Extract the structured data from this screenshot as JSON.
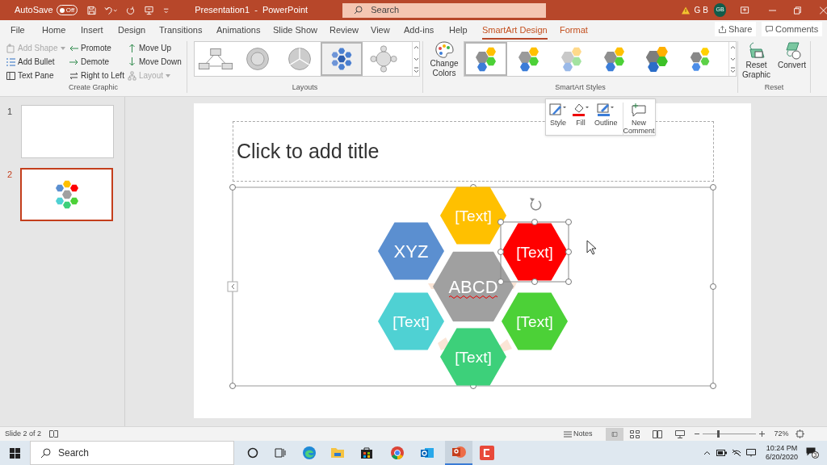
{
  "window": {
    "autosave_label": "AutoSave",
    "autosave_toggle": "Off",
    "autosave_on": false,
    "title": "Presentation1  -  PowerPoint",
    "search_placeholder": "Search",
    "user_initials": "G B",
    "avatar": "GB"
  },
  "tabs": [
    {
      "label": "File",
      "selected": false,
      "kind": "normal"
    },
    {
      "label": "Home",
      "selected": false,
      "kind": "normal"
    },
    {
      "label": "Insert",
      "selected": false,
      "kind": "normal"
    },
    {
      "label": "Design",
      "selected": false,
      "kind": "normal"
    },
    {
      "label": "Transitions",
      "selected": false,
      "kind": "normal"
    },
    {
      "label": "Animations",
      "selected": false,
      "kind": "normal"
    },
    {
      "label": "Slide Show",
      "selected": false,
      "kind": "normal"
    },
    {
      "label": "Review",
      "selected": false,
      "kind": "normal"
    },
    {
      "label": "View",
      "selected": false,
      "kind": "normal"
    },
    {
      "label": "Add-ins",
      "selected": false,
      "kind": "normal"
    },
    {
      "label": "Help",
      "selected": false,
      "kind": "normal"
    },
    {
      "label": "SmartArt Design",
      "selected": true,
      "kind": "contextual"
    },
    {
      "label": "Format",
      "selected": false,
      "kind": "contextual"
    }
  ],
  "share": "Share",
  "comments": "Comments",
  "create_graphic": {
    "label": "Create Graphic",
    "items": [
      {
        "label": "Add Shape",
        "disabled": true,
        "dropdown": true
      },
      {
        "label": "Add Bullet",
        "disabled": false,
        "dropdown": false
      },
      {
        "label": "Text Pane",
        "disabled": false,
        "dropdown": false
      },
      {
        "label": "Promote",
        "disabled": false,
        "dropdown": false
      },
      {
        "label": "Demote",
        "disabled": false,
        "dropdown": false
      },
      {
        "label": "Right to Left",
        "disabled": false,
        "dropdown": false
      },
      {
        "label": "Move Up",
        "disabled": false,
        "dropdown": false
      },
      {
        "label": "Move Down",
        "disabled": false,
        "dropdown": false
      },
      {
        "label": "Layout",
        "disabled": true,
        "dropdown": true
      }
    ]
  },
  "layouts": {
    "label": "Layouts",
    "thumbnails": [
      {
        "kind": "hierarchy",
        "selected": false
      },
      {
        "kind": "cycle",
        "selected": false
      },
      {
        "kind": "pie",
        "selected": false
      },
      {
        "kind": "hexagon",
        "selected": true
      },
      {
        "kind": "radial",
        "selected": false
      }
    ]
  },
  "smartart_styles": {
    "change_colors": "Change Colors",
    "label": "SmartArt Styles",
    "styles": [
      {
        "selected": true
      },
      {
        "selected": false
      },
      {
        "selected": false
      },
      {
        "selected": false
      },
      {
        "selected": false
      },
      {
        "selected": false
      }
    ]
  },
  "reset": {
    "label": "Reset",
    "buttons": [
      "Reset Graphic",
      "Convert"
    ]
  },
  "floating_toolbar": [
    "Style",
    "Fill",
    "Outline",
    "New Comment"
  ],
  "slide_thumbnails": [
    {
      "number": "1",
      "selected": false
    },
    {
      "number": "2",
      "selected": true
    }
  ],
  "slide": {
    "title_placeholder": "Click to add title",
    "shapes": [
      {
        "text": "[Text]",
        "color": "#ffc000",
        "selected": false,
        "spelling_error": false
      },
      {
        "text": "[Text]",
        "color": "#ff0000",
        "selected": true,
        "spelling_error": false
      },
      {
        "text": "[Text]",
        "color": "#4cd137",
        "selected": false,
        "spelling_error": false
      },
      {
        "text": "[Text]",
        "color": "#3dd07a",
        "selected": false,
        "spelling_error": false
      },
      {
        "text": "[Text]",
        "color": "#4fd1d3",
        "selected": false,
        "spelling_error": false
      },
      {
        "text": "XYZ",
        "color": "#5b8fd0",
        "selected": false,
        "spelling_error": false
      },
      {
        "text": "ABCD",
        "color": "#a0a0a0",
        "selected": false,
        "spelling_error": true
      }
    ]
  },
  "status_bar": {
    "slide_count": "Slide 2 of 2",
    "notes": "Notes",
    "zoom": "72%",
    "zoom_slider": {
      "level": 0.3
    }
  },
  "taskbar": {
    "search_placeholder": "Search",
    "time": "10:24 PM",
    "date": "6/20/2020",
    "notifications": "3"
  }
}
